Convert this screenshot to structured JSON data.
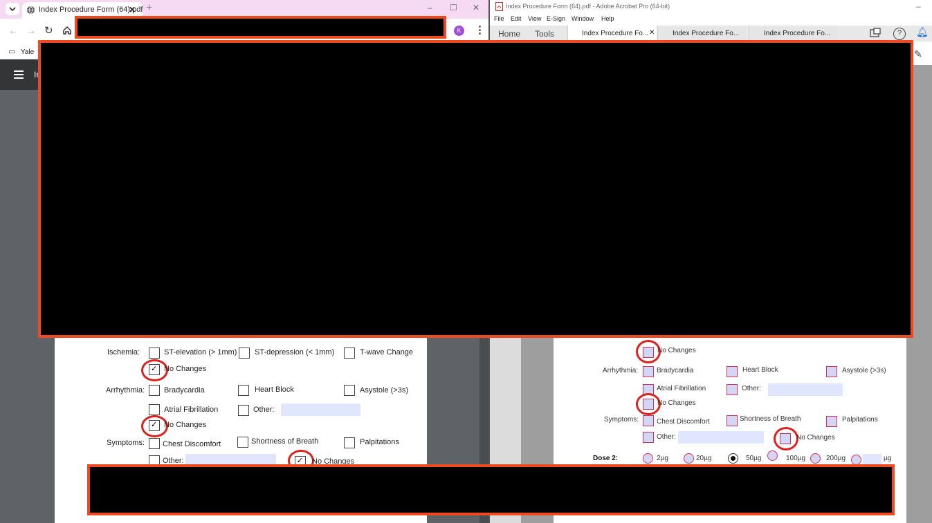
{
  "chrome": {
    "tab_title": "Index Procedure Form (64).pdf",
    "tab_close": "✕",
    "new_tab": "+",
    "window_controls": [
      "–",
      "☐",
      "✕"
    ],
    "profile_initial": "K",
    "bookmark_label": "Yale",
    "pdf_toolbar_fragment": "In",
    "form": {
      "ischemia_label": "Ischemia:",
      "ischemia_options": [
        "ST-elevation (> 1mm)",
        "ST-depression (< 1mm)",
        "T-wave Change"
      ],
      "no_changes": "No Changes",
      "arrhythmia_label": "Arrhythmia:",
      "arrhythmia_options": [
        "Bradycardia",
        "Heart Block",
        "Asystole (>3s)",
        "Atrial Fibrillation",
        "Other:"
      ],
      "symptoms_label": "Symptoms:",
      "symptoms_options": [
        "Chest Discomfort",
        "Shortness of Breath",
        "Palpitations",
        "Other:"
      ]
    }
  },
  "acrobat": {
    "window_title": "Index Procedure Form (64).pdf - Adobe Acrobat Pro (64-bit)",
    "menu": [
      "File",
      "Edit",
      "View",
      "E-Sign",
      "Window",
      "Help"
    ],
    "nav": [
      "Home",
      "Tools"
    ],
    "doc_tabs": [
      "Index Procedure Fo...",
      "Index Procedure Fo...",
      "Index Procedure Fo..."
    ],
    "tab_close": "✕",
    "form": {
      "no_changes": "No Changes",
      "arrhythmia_label": "Arrhythmia:",
      "arrhythmia_options": [
        "Bradycardia",
        "Heart Block",
        "Asystole (>3s)",
        "Atrial Fibrillation",
        "Other:"
      ],
      "symptoms_label": "Symptoms:",
      "symptoms_options": [
        "Chest Discomfort",
        "Shortness of Breath",
        "Palpitations",
        "Other:"
      ],
      "dose_label": "Dose 2:",
      "dose_options": [
        "2µg",
        "20µg",
        "50µg",
        "100µg",
        "200µg",
        "µg"
      ],
      "dose_selected": "50µg"
    }
  },
  "colors": {
    "redaction_border": "#ef4a1e",
    "annotation_ring": "#e0201a",
    "chrome_tabstrip": "#f6d9f3",
    "acrobat_field_fill": "#d4d6f5"
  }
}
